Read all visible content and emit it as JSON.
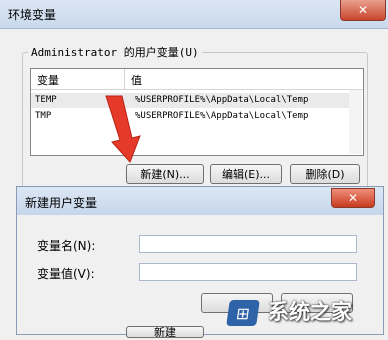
{
  "window": {
    "title": "环境变量",
    "close_glyph": "✕"
  },
  "user_vars": {
    "group_label": "Administrator 的用户变量(U)",
    "columns": [
      "变量",
      "值"
    ],
    "rows": [
      {
        "name": "TEMP",
        "value": "%USERPROFILE%\\AppData\\Local\\Temp"
      },
      {
        "name": "TMP",
        "value": "%USERPROFILE%\\AppData\\Local\\Temp"
      }
    ],
    "buttons": {
      "new": "新建(N)...",
      "edit": "编辑(E)...",
      "delete": "删除(D)"
    }
  },
  "new_dialog": {
    "title": "新建用户变量",
    "close_glyph": "✕",
    "name_label": "变量名(N):",
    "value_label": "变量值(V):",
    "name_value": "",
    "value_value": ""
  },
  "bottom_partial": {
    "new_label": "新建"
  },
  "watermark": {
    "text": "系统之家",
    "logo_glyph": "⊞"
  },
  "colors": {
    "arrow": "#e53a2a",
    "close_red": "#c9462c",
    "titlebar": "#c9d9ec"
  }
}
